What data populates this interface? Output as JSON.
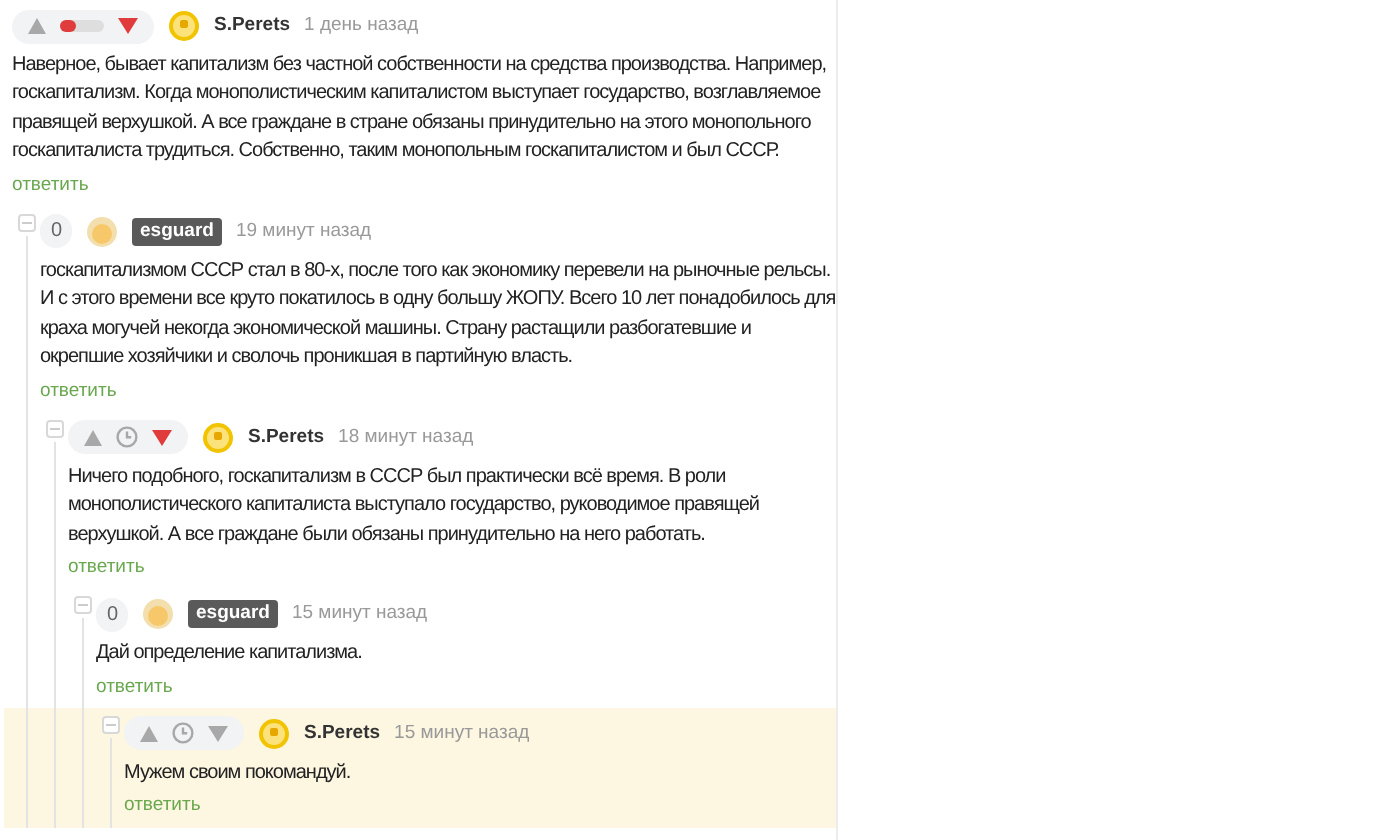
{
  "comments": [
    {
      "author": "S.Perets",
      "author_badge": false,
      "time": "1 день назад",
      "rating": {
        "kind": "bar"
      },
      "downvoted": true,
      "highlighted": false,
      "text": "Наверное, бывает капитализм без частной собственности на средства производства. Например, госкапитализм. Когда монополистическим капиталистом выступает государство, возглавляемое правящей верхушкой. А все граждане в стране обязаны принудительно на этого монопольного госкапиталиста трудиться. Собственно, таким монопольным госкапиталистом и был СССР.",
      "reply": "ответить",
      "children": [
        {
          "author": "esguard",
          "author_badge": true,
          "time": "19 минут назад",
          "rating": {
            "kind": "count",
            "value": "0"
          },
          "highlighted": false,
          "text": "госкапитализмом СССР стал в 80-х, после того как экономику перевели на рыночные рельсы. И с этого времени все круто покатилось в одну большу ЖОПУ. Всего 10 лет понадобилось для краха могучей некогда экономической машины. Страну растащили разбогатевшие и окрепшие хозяйчики и сволочь проникшая в партийную власть.",
          "reply": "ответить",
          "children": [
            {
              "author": "S.Perets",
              "author_badge": false,
              "time": "18 минут назад",
              "rating": {
                "kind": "pending"
              },
              "downvoted": true,
              "highlighted": false,
              "text": "Ничего подобного, госкапитализм в СССР был практически всё время. В роли монополистического капиталиста выступало государство, руководимое правящей верхушкой. А все граждане были обязаны принудительно на него работать.",
              "reply": "ответить",
              "children": [
                {
                  "author": "esguard",
                  "author_badge": true,
                  "time": "15 минут назад",
                  "rating": {
                    "kind": "count",
                    "value": "0"
                  },
                  "highlighted": false,
                  "text": "Дай определение капитализма.",
                  "reply": "ответить",
                  "children": [
                    {
                      "author": "S.Perets",
                      "author_badge": false,
                      "time": "15 минут назад",
                      "rating": {
                        "kind": "pending"
                      },
                      "downvoted": false,
                      "highlighted": true,
                      "text": "Мужем своим покомандуй.",
                      "reply": "ответить"
                    }
                  ]
                }
              ]
            }
          ]
        }
      ]
    }
  ]
}
